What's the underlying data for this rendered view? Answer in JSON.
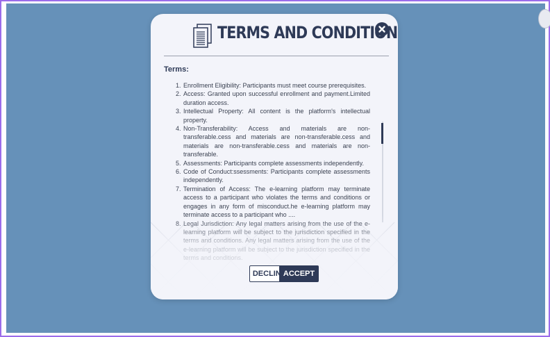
{
  "modal": {
    "title": "TERMS AND CONDITION",
    "section_heading": "Terms:",
    "icons": {
      "document": "document-icon",
      "close": "close-icon"
    },
    "terms": [
      {
        "number": "1.",
        "text": "Enrollment Eligibility: Participants must meet course prerequisites."
      },
      {
        "number": "2.",
        "text": "Access: Granted upon successful enrollment and payment.Limited duration access."
      },
      {
        "number": "3.",
        "text": "Intellectual Property: All content is the platform's intellectual property."
      },
      {
        "number": "4.",
        "text": "Non-Transferability: Access and materials are non-transferable.cess and materials are non-transferable.cess and materials are non-transferable.cess and materials are non-transferable."
      },
      {
        "number": "5.",
        "text": "Assessments: Participants complete assessments independently."
      },
      {
        "number": "6.",
        "text": "Code of Conduct:ssessments: Participants complete assessments independently."
      },
      {
        "number": "7.",
        "text": "Termination of Access: The e-learning platform may terminate access to a participant who violates the terms and conditions or engages in any form of misconduct.he e-learning platform may terminate access to a participant who ...."
      },
      {
        "number": "8.",
        "text": "Legal Jurisdiction: Any legal matters arising from the use of the e-learning platform will be subject to the jurisdiction specified in the terms and conditions. Any legal matters arising from the use of the e-learning platform will be subject to the jurisdiction specified in the terms and conditions."
      }
    ],
    "buttons": {
      "decline": "DECLINE",
      "accept": "ACCEPT"
    }
  },
  "colors": {
    "backdrop": "#6691b9",
    "frame": "#9b6dea",
    "modal_bg": "#f3f4fa",
    "primary": "#2e3a57",
    "text": "#3b4252"
  }
}
